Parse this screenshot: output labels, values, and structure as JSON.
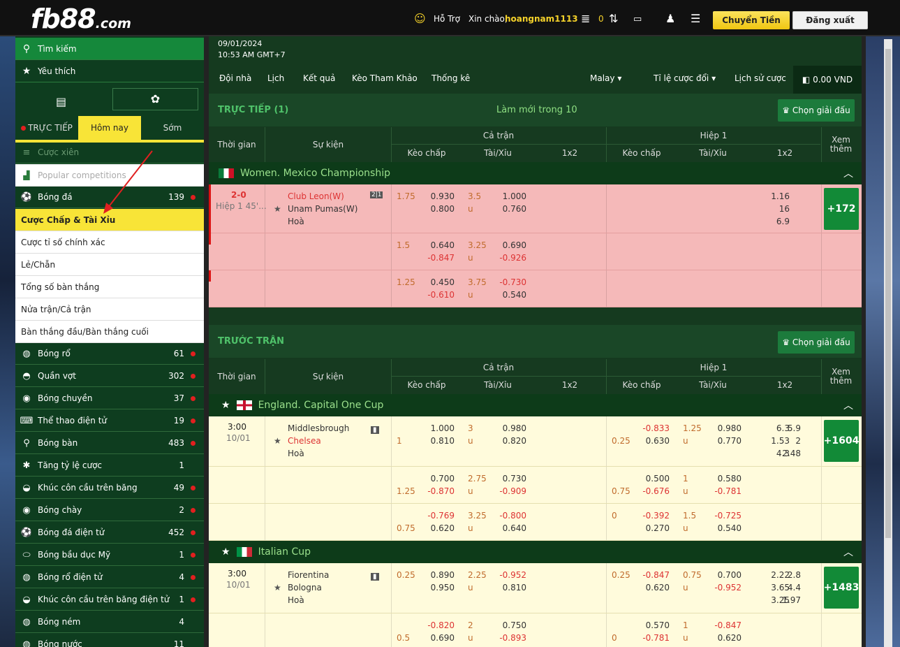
{
  "header": {
    "logo": "fb88",
    "logo_domain": ".com",
    "support": "Hỗ Trợ",
    "greeting": "Xin chào,",
    "username": "hoangnam1113",
    "balance_count": "0",
    "transfer_button": "Chuyển Tiền",
    "logout_button": "Đăng xuất"
  },
  "sidebar": {
    "search": "Tìm kiếm",
    "favorites": "Yêu thích",
    "tabs": [
      "TRỰC TIẾP",
      "Hôm nay",
      "Sớm"
    ],
    "parlay": "Cược xiên",
    "popular": "Popular competitions",
    "sports_top": {
      "label": "Bóng đá",
      "count": "139"
    },
    "sub_items": [
      "Cược Chấp & Tài Xỉu",
      "Cược tỉ số chính xác",
      "Lẻ/Chẵn",
      "Tổng số bàn thắng",
      "Nửa trận/Cả trận",
      "Bàn thắng đầu/Bàn thắng cuối"
    ],
    "sports": [
      {
        "label": "Bóng rổ",
        "count": "61",
        "dot": true
      },
      {
        "label": "Quần vợt",
        "count": "302",
        "dot": true
      },
      {
        "label": "Bóng chuyền",
        "count": "37",
        "dot": true
      },
      {
        "label": "Thể thao điện tử",
        "count": "19",
        "dot": true
      },
      {
        "label": "Bóng bàn",
        "count": "483",
        "dot": true
      },
      {
        "label": "Tăng tỷ lệ cược",
        "count": "1",
        "dot": false
      },
      {
        "label": "Khúc côn cầu trên băng",
        "count": "49",
        "dot": true
      },
      {
        "label": "Bóng chày",
        "count": "2",
        "dot": true
      },
      {
        "label": "Bóng đá điện tử",
        "count": "452",
        "dot": true
      },
      {
        "label": "Bóng bầu dục Mỹ",
        "count": "1",
        "dot": true
      },
      {
        "label": "Bóng rổ điện tử",
        "count": "4",
        "dot": true
      },
      {
        "label": "Khúc côn cầu trên băng điện tử",
        "count": "1",
        "dot": true
      },
      {
        "label": "Bóng ném",
        "count": "4",
        "dot": false
      },
      {
        "label": "Bóng nước",
        "count": "11",
        "dot": false
      }
    ]
  },
  "main": {
    "date": "09/01/2024",
    "time": "10:53 AM GMT+7",
    "nav": [
      "Đội nhà",
      "Lịch",
      "Kết quả",
      "Kèo Tham Khảo",
      "Thống kê"
    ],
    "odds_type": "Malay",
    "odds_change": "Tỉ lệ cược đổi",
    "bet_history": "Lịch sử cược",
    "wallet": "0.00 VND",
    "live_label": "TRỰC TIẾP (1)",
    "refresh": "Làm mới trong 10",
    "choose_league": "Chọn giải đấu",
    "pre_label": "TRƯỚC TRẬN",
    "cols": {
      "time": "Thời gian",
      "event": "Sự kiện",
      "full": "Cả trận",
      "half": "Hiệp 1",
      "hdp": "Kèo chấp",
      "ou": "Tài/Xỉu",
      "x12": "1x2",
      "more": "Xem thêm"
    }
  },
  "live_league": {
    "name": "Women. Mexico Championship",
    "score": "2-0",
    "period": "Hiệp 1 45'...",
    "home": "Club Leon(W)",
    "away": "Unam Pumas(W)",
    "draw": "Hoà",
    "more": "+172",
    "lines": [
      {
        "hdp": "1.75",
        "h1": "0.930",
        "h2": "0.800",
        "ou": "3.5",
        "ou_u": "u",
        "o1": "1.000",
        "o2": "0.760",
        "x1": "1.16",
        "x2": "16",
        "xd": "6.9"
      },
      {
        "hdp": "1.5",
        "h1": "0.640",
        "h2": "-0.847",
        "ou": "3.25",
        "ou_u": "u",
        "o1": "0.690",
        "o2": "-0.926"
      },
      {
        "hdp": "1.25",
        "h1": "0.450",
        "h2": "-0.610",
        "ou": "3.75",
        "ou_u": "u",
        "o1": "-0.730",
        "o2": "0.540"
      }
    ]
  },
  "pre_leagues": [
    {
      "name": "England. Capital One Cup",
      "time": "3:00",
      "date": "10/01",
      "home": "Middlesbrough",
      "away": "Chelsea",
      "draw": "Hoà",
      "more": "+1604",
      "lines": [
        {
          "fh": "",
          "fhl": "1",
          "h1": "1.000",
          "h2": "0.810",
          "ou": "3",
          "u": "u",
          "o1": "0.980",
          "o2": "0.820",
          "x1": "6.3",
          "x2": "1.53",
          "xd": "4.3",
          "hh": "",
          "hhl": "0.25",
          "hh1": "-0.833",
          "hh2": "0.630",
          "hou": "1.25",
          "hu": "u",
          "ho1": "0.980",
          "ho2": "0.770",
          "hx1": "5.9",
          "hx2": "2",
          "hxd": "2.48"
        },
        {
          "fhl": "1.25",
          "h1": "0.700",
          "h2": "-0.870",
          "ou": "2.75",
          "u": "u",
          "o1": "0.730",
          "o2": "-0.909",
          "hhl": "0.75",
          "hh1": "0.500",
          "hh2": "-0.676",
          "hou": "1",
          "hu": "u",
          "ho1": "0.580",
          "ho2": "-0.781"
        },
        {
          "fhl": "0.75",
          "h1": "-0.769",
          "h2": "0.620",
          "ou": "3.25",
          "u": "u",
          "o1": "-0.800",
          "o2": "0.640",
          "hhl": "0",
          "hh1": "-0.392",
          "hh2": "0.270",
          "hou": "1.5",
          "hu": "u",
          "ho1": "-0.725",
          "ho2": "0.540"
        }
      ]
    },
    {
      "name": "Italian Cup",
      "time": "3:00",
      "date": "10/01",
      "home": "Fiorentina",
      "away": "Bologna",
      "draw": "Hoà",
      "more": "+1483",
      "lines": [
        {
          "fhl": "0.25",
          "h1": "0.890",
          "h2": "0.950",
          "ou": "2.25",
          "u": "u",
          "o1": "-0.952",
          "o2": "0.810",
          "x1": "2.22",
          "x2": "3.65",
          "xd": "3.25",
          "hhl": "0.25",
          "hh1": "-0.847",
          "hh2": "0.620",
          "hou": "0.75",
          "hu": "u",
          "ho1": "0.700",
          "ho2": "-0.952",
          "hx1": "2.8",
          "hx2": "4.4",
          "hxd": "1.97"
        },
        {
          "fhl": "0.5",
          "h1": "-0.820",
          "h2": "0.690",
          "ou": "2",
          "u": "u",
          "o1": "0.750",
          "o2": "-0.893",
          "hhl": "0",
          "hh1": "0.570",
          "hh2": "-0.781",
          "hou": "1",
          "hu": "u",
          "ho1": "-0.847",
          "ho2": "0.620"
        }
      ]
    }
  ]
}
